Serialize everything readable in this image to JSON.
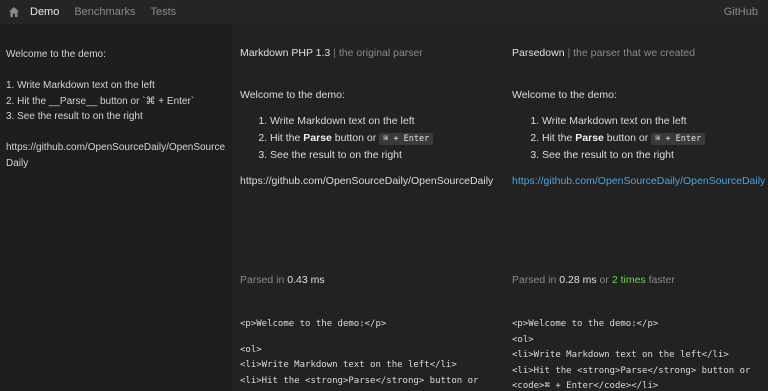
{
  "nav": {
    "home_icon": "home-icon",
    "links": [
      "Demo",
      "Benchmarks",
      "Tests"
    ],
    "right_link": "GitHub"
  },
  "editor": {
    "text": "Welcome to the demo:\n\n1. Write Markdown text on the left\n2. Hit the __Parse__ button or `⌘ + Enter`\n3. See the result to on the right\n\nhttps://github.com/OpenSourceDaily/OpenSourceDaily"
  },
  "col_a": {
    "title": "Markdown PHP 1.3",
    "separator": "|",
    "subtitle": "the original parser",
    "welcome": "Welcome to the demo:",
    "item1": "Write Markdown text on the left",
    "item2_pre": "Hit the ",
    "item2_bold": "Parse",
    "item2_mid": " button or ",
    "item2_kbd": "⌘ + Enter",
    "item3": "See the result to on the right",
    "url": "https://github.com/OpenSourceDaily/OpenSourceDaily",
    "timing_pre": "Parsed in ",
    "timing_val": "0.43 ms",
    "code": [
      "<p>Welcome to the demo:</p>",
      "",
      "<ol>",
      "<li>Write Markdown text on the left</li>",
      "<li>Hit the <strong>Parse</strong> button or"
    ]
  },
  "col_b": {
    "title": "Parsedown",
    "separator": "|",
    "subtitle": "the parser that we created",
    "welcome": "Welcome to the demo:",
    "item1": "Write Markdown text on the left",
    "item2_pre": "Hit the ",
    "item2_bold": "Parse",
    "item2_mid": " button or ",
    "item2_kbd": "⌘ + Enter",
    "item3": "See the result to on the right",
    "url": "https://github.com/OpenSourceDaily/OpenSourceDaily",
    "timing_pre": "Parsed in ",
    "timing_val": "0.28 ms",
    "timing_or": " or ",
    "timing_times": "2 times",
    "timing_post": " faster",
    "code": [
      "<p>Welcome to the demo:</p>",
      "<ol>",
      "<li>Write Markdown text on the left</li>",
      "<li>Hit the <strong>Parse</strong> button or",
      "<code>⌘ + Enter</code></li>"
    ]
  },
  "colors": {
    "background": "#1e1e1e",
    "link_blue": "#4fa3d8",
    "green": "#6fcf5a"
  }
}
